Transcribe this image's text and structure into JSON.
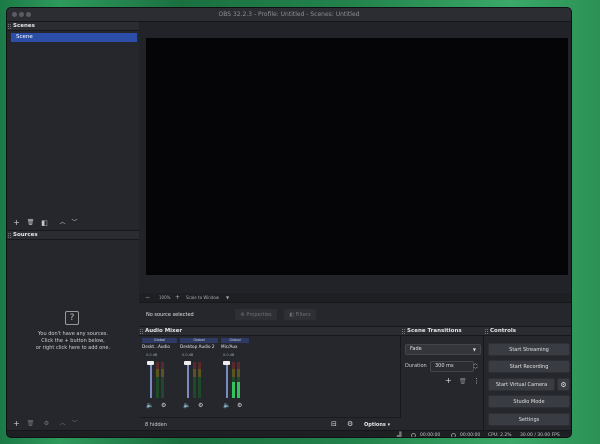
{
  "window": {
    "title": "OBS 32.2.3 - Profile: Untitled - Scenes: Untitled"
  },
  "scenes": {
    "header": "Scenes",
    "items": [
      "Scene"
    ],
    "toolbar_icons": [
      "add-icon",
      "trash-icon",
      "filter-icon",
      "up-arrow-icon",
      "down-arrow-icon"
    ]
  },
  "sources": {
    "header": "Sources",
    "empty_icon": "?",
    "empty_line1": "You don't have any sources.",
    "empty_line2": "Click the + button below,",
    "empty_line3": "or right click here to add one."
  },
  "preview": {
    "zoom_minus": "−",
    "zoom_value": "100%",
    "zoom_plus": "+",
    "zoom_mode": "Scale to Window"
  },
  "source_bar": {
    "status": "No source selected",
    "properties_label": "Properties",
    "filters_label": "Filters"
  },
  "audio_mixer": {
    "header": "Audio Mixer",
    "channels": [
      {
        "tag": "Global",
        "name": "Deskt...Audio",
        "db": "0.0 dB",
        "level": 0.0
      },
      {
        "tag": "Global",
        "name": "Desktop Audio 2",
        "db": "0.0 dB",
        "level": 0.0
      },
      {
        "tag": "Global",
        "name": "Mic/Aux",
        "db": "0.0 dB",
        "level": 0.45
      }
    ],
    "hidden_label": "8 hidden",
    "options_label": "Options"
  },
  "transitions": {
    "header": "Scene Transitions",
    "selected": "Fade",
    "duration_label": "Duration",
    "duration_value": "300 ms"
  },
  "controls": {
    "header": "Controls",
    "start_streaming": "Start Streaming",
    "start_recording": "Start Recording",
    "start_virtual_camera": "Start Virtual Camera",
    "studio_mode": "Studio Mode",
    "settings": "Settings"
  },
  "status": {
    "stream_time": "00:00:00",
    "record_time": "00:00:00",
    "cpu": "CPU: 2.2%",
    "fps": "30.00 / 30.00 FPS"
  }
}
